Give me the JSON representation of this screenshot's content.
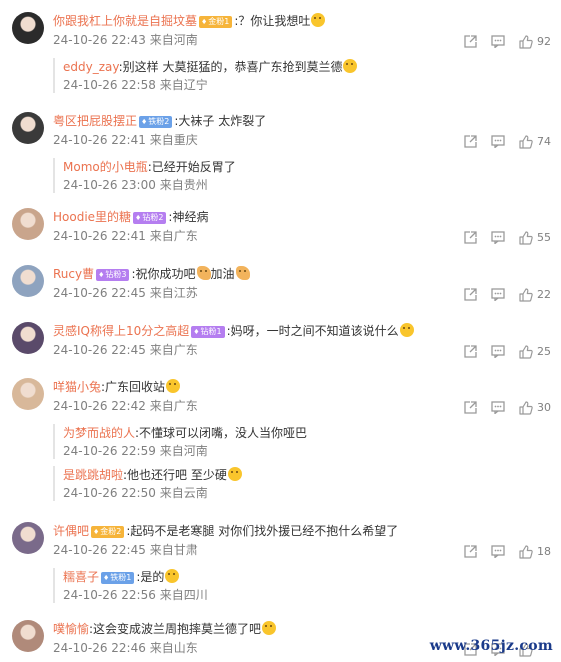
{
  "comments": [
    {
      "user": "你跟我杠上你就是自掘坟墓",
      "badge": {
        "text": "金粉1",
        "style": "gold"
      },
      "text": ":？你让我想吐",
      "emoji": "face",
      "date": "24-10-26 22:43",
      "location": "来自河南",
      "likes": "92",
      "avatar_color": "#2b2b2b",
      "replies": [
        {
          "user": "eddy_zay",
          "text": ":别这样 大莫挺猛的，恭喜广东抢到莫兰德",
          "emoji": "face",
          "date": "24-10-26 22:58",
          "location": "来自辽宁"
        }
      ]
    },
    {
      "user": "粤区把屁股摆正",
      "badge": {
        "text": "铁粉2",
        "style": "blue"
      },
      "text": ":大袜子 太炸裂了",
      "emoji": "",
      "date": "24-10-26 22:41",
      "location": "来自重庆",
      "likes": "74",
      "avatar_color": "#3a3a3a",
      "replies": [
        {
          "user": "Momo的小电瓶",
          "text": ":已经开始反胃了",
          "emoji": "",
          "date": "24-10-26 23:00",
          "location": "来自贵州"
        }
      ]
    },
    {
      "user": "Hoodie里的糖",
      "badge": {
        "text": "钻粉2",
        "style": "purple"
      },
      "text": ":神经病",
      "emoji": "",
      "date": "24-10-26 22:41",
      "location": "来自广东",
      "likes": "55",
      "avatar_color": "#c9a58c",
      "replies": []
    },
    {
      "user": "Rucy曹",
      "badge": {
        "text": "钻粉3",
        "style": "purple"
      },
      "text": ":祝你成功吧",
      "emoji": "hands",
      "text2": "加油",
      "emoji2": "hands",
      "date": "24-10-26 22:45",
      "location": "来自江苏",
      "likes": "22",
      "avatar_color": "#8ea3bf",
      "replies": []
    },
    {
      "user": "灵感IQ称得上10分之高超",
      "badge": {
        "text": "钻粉1",
        "style": "purple"
      },
      "text": ":妈呀，一时之间不知道该说什么",
      "emoji": "face",
      "date": "24-10-26 22:45",
      "location": "来自广东",
      "likes": "25",
      "avatar_color": "#5a4a6a",
      "replies": []
    },
    {
      "user": "咩猫小兔",
      "badge": {
        "text": "",
        "style": "none"
      },
      "text": ":广东回收站",
      "emoji": "face",
      "date": "24-10-26 22:42",
      "location": "来自广东",
      "likes": "30",
      "avatar_color": "#d8b89a",
      "replies": [
        {
          "user": "为梦而战的人",
          "text": ":不懂球可以闭嘴，没人当你哑巴",
          "emoji": "",
          "date": "24-10-26 22:59",
          "location": "来自河南"
        },
        {
          "user": "是跳跳胡啦",
          "text": ":他也还行吧 至少硬",
          "emoji": "face",
          "date": "24-10-26 22:50",
          "location": "来自云南"
        }
      ]
    },
    {
      "user": "许偶吧",
      "badge": {
        "text": "金粉2",
        "style": "gold"
      },
      "text": ":起码不是老寒腿 对你们找外援已经不抱什么希望了",
      "emoji": "",
      "date": "24-10-26 22:45",
      "location": "来自甘肃",
      "likes": "18",
      "avatar_color": "#7a6a8a",
      "replies": [
        {
          "user": "糯喜子",
          "badge": {
            "text": "铁粉1",
            "style": "blue"
          },
          "text": ":是的",
          "emoji": "face",
          "date": "24-10-26 22:56",
          "location": "来自四川"
        }
      ]
    },
    {
      "user": "噗愉愉",
      "badge": {
        "text": "",
        "style": "none"
      },
      "text": ":这会变成波兰周抱摔莫兰德了吧",
      "emoji": "face",
      "date": "24-10-26 22:46",
      "location": "来自山东",
      "likes": "",
      "avatar_color": "#b08a7a",
      "replies": []
    }
  ],
  "watermark": "www.365jz.com"
}
